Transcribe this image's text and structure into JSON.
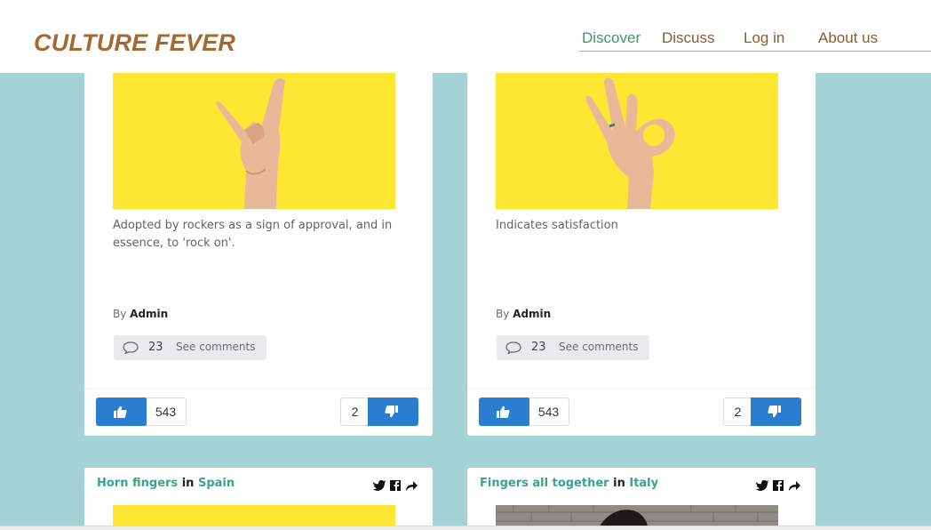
{
  "header": {
    "logo": "CULTURE FEVER",
    "nav": [
      {
        "label": "Discover",
        "active": true
      },
      {
        "label": "Discuss",
        "active": false
      },
      {
        "label": "Log in",
        "active": false
      },
      {
        "label": "About us",
        "active": false
      }
    ]
  },
  "colors": {
    "background": "#a3d3d4",
    "logo": "#a26a32",
    "nav_active": "#3a9a68",
    "nav": "#8b5a2b",
    "vote_button": "#2b7dd0",
    "link": "#3aa38a",
    "image_yellow": "#fde733"
  },
  "cards": [
    {
      "image": "horn-fingers-hand-image",
      "description": "Adopted by rockers as a sign of approval, and in essence, to 'rock on'.",
      "author_prefix": "By",
      "author": "Admin",
      "comments_icon": "speech-bubble-icon",
      "comments_count": "23",
      "comments_label": "See comments",
      "likes": "543",
      "dislikes": "2"
    },
    {
      "image": "ok-sign-hand-image",
      "description": "Indicates satisfaction",
      "author_prefix": "By",
      "author": "Admin",
      "comments_icon": "speech-bubble-icon",
      "comments_count": "23",
      "comments_label": "See comments",
      "likes": "543",
      "dislikes": "2"
    }
  ],
  "next_cards": [
    {
      "gesture": "Horn fingers",
      "in_word": "in",
      "country": "Spain"
    },
    {
      "gesture": "Fingers all together",
      "in_word": "in",
      "country": "Italy"
    }
  ],
  "share_icons": [
    "twitter-icon",
    "facebook-icon",
    "share-arrow-icon"
  ]
}
